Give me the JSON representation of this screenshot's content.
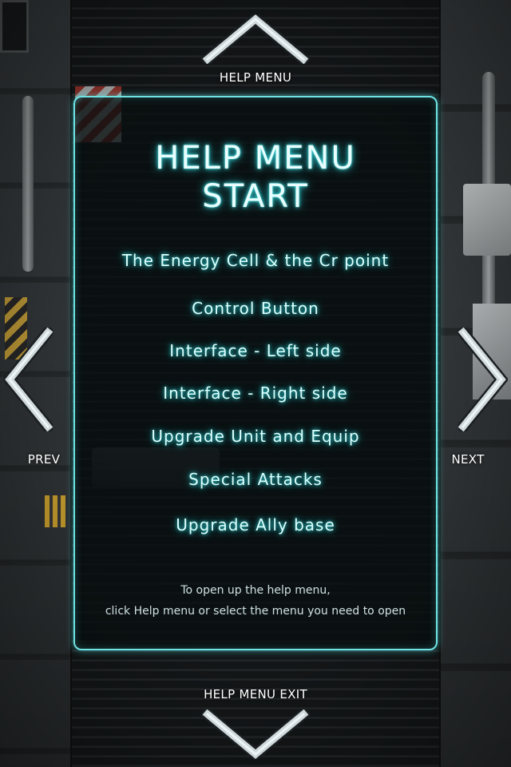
{
  "nav": {
    "up_label": "HELP MENU",
    "down_label": "HELP MENU EXIT",
    "prev_label": "PREV",
    "next_label": "NEXT"
  },
  "panel": {
    "title_line1": "HELP MENU",
    "title_line2": "START",
    "items": [
      {
        "label": "The Energy Cell & the Cr point"
      },
      {
        "label": "Control Button"
      },
      {
        "label": "Interface - Left side"
      },
      {
        "label": "Interface - Right side"
      },
      {
        "label": "Upgrade Unit and Equip"
      },
      {
        "label": "Special Attacks"
      },
      {
        "label": "Upgrade Ally base"
      }
    ],
    "hint_line1": "To open up the help menu,",
    "hint_line2": "click Help menu or select the menu you need to open"
  },
  "colors": {
    "accent": "#6fe3e3",
    "glow": "#2dcfd3",
    "arrow": "#cfd8da"
  },
  "icons": {
    "up": "chevron-up-icon",
    "down": "chevron-down-icon",
    "prev": "chevron-left-icon",
    "next": "chevron-right-icon"
  }
}
